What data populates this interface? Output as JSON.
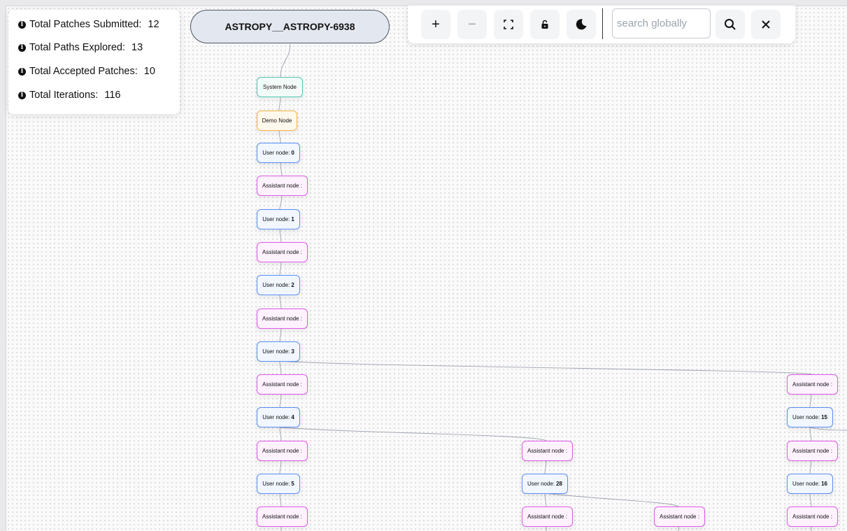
{
  "stats": [
    {
      "label": "Total Patches Submitted:",
      "value": "12"
    },
    {
      "label": "Total Paths Explored:",
      "value": "13"
    },
    {
      "label": "Total Accepted Patches:",
      "value": "10"
    },
    {
      "label": "Total Iterations:",
      "value": "116"
    }
  ],
  "root": {
    "label": "ASTROPY__ASTROPY-6938"
  },
  "toolbar": {
    "zoom_in": "+",
    "zoom_out": "−",
    "search_placeholder": "search globally"
  },
  "nodes": {
    "system": "System Node",
    "demo": "Demo Node",
    "user_prefix": "User node:",
    "assistant": "Assistant node :",
    "user_ids": {
      "u0": "0",
      "u1": "1",
      "u2": "2",
      "u3": "3",
      "u4": "4",
      "u5": "5",
      "u15": "15",
      "u16": "16",
      "u28": "28"
    }
  },
  "colors": {
    "system": "#4fc7b4",
    "demo": "#f5b340",
    "user": "#5b8ff5",
    "assistant": "#e05ae6"
  }
}
